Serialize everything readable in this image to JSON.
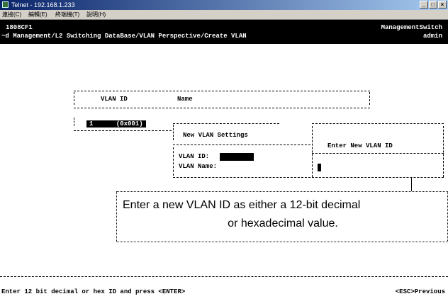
{
  "window": {
    "title": "Telnet - 192.168.1.233"
  },
  "menu": [
    "連接(C)",
    "編輯(E)",
    "終端機(T)",
    "說明(H)"
  ],
  "header": {
    "left_line1": "1808CF1",
    "right_line1": "ManagementSwitch",
    "left_line2": "~d Management/L2 Switching DataBase/VLAN Perspective/Create VLAN",
    "right_line2": "admin"
  },
  "vlan_table": {
    "col1": "VLAN ID",
    "col2": "Name",
    "row1_value": "1      (0x001)"
  },
  "settings_panel": {
    "title": "New VLAN Settings",
    "vlan_id_label": "VLAN ID:",
    "vlan_name_label": "VLAN Name:"
  },
  "prompt_box": {
    "title": "Enter New VLAN ID"
  },
  "callout": {
    "line1": "Enter a new VLAN ID as either a 12-bit decimal",
    "line2": "or hexadecimal value."
  },
  "footer": {
    "left": "Enter 12 bit decimal or hex ID and press <ENTER>",
    "right": "<ESC>Previous"
  }
}
